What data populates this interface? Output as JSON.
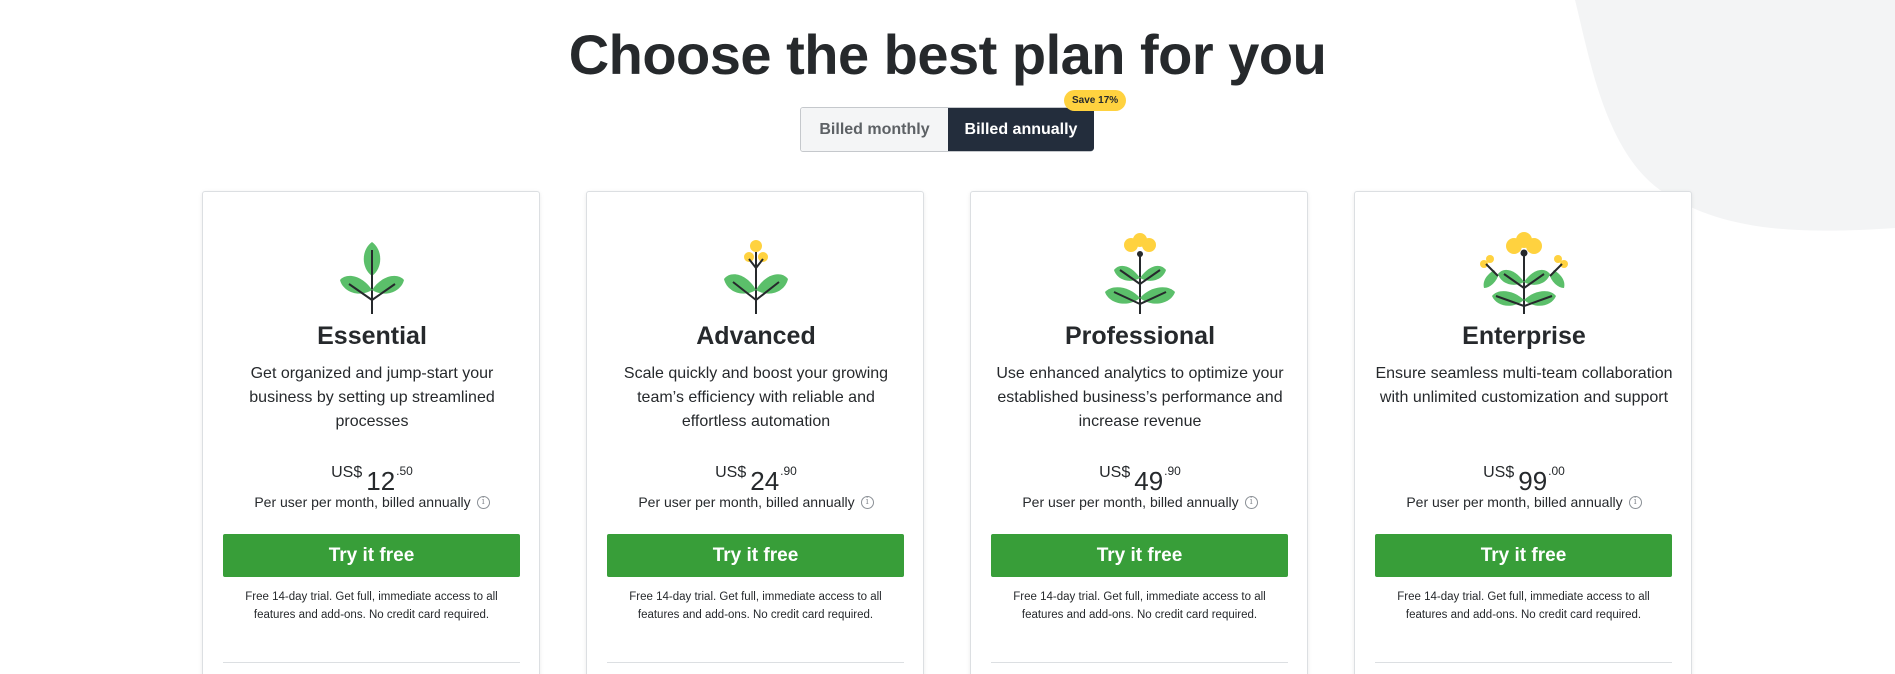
{
  "page": {
    "title": "Choose the best plan for you"
  },
  "billing_toggle": {
    "monthly_label": "Billed monthly",
    "annual_label": "Billed annually",
    "selected": "annual",
    "save_badge": "Save 17%"
  },
  "colors": {
    "dark_navy": "#232d3c",
    "cta_green": "#389e39",
    "leaf_green": "#5bbf6a",
    "flower_yellow": "#ffd23f",
    "badge_yellow": "#ffd23f",
    "background_blob": "#f4f5f6"
  },
  "plans": [
    {
      "name": "Essential",
      "icon": "plant-sprout-icon",
      "description": "Get organized and jump-start your business by setting up streamlined processes",
      "currency": "US$",
      "price_whole": "12",
      "price_cents": ".50",
      "billing_note": "Per user per month, billed annually",
      "cta": "Try it free",
      "trial_note": "Free 14-day trial. Get full, immediate access to all features and add-ons. No credit card required."
    },
    {
      "name": "Advanced",
      "icon": "plant-budding-icon",
      "description": "Scale quickly and boost your growing team’s efficiency with reliable and effortless automation",
      "currency": "US$",
      "price_whole": "24",
      "price_cents": ".90",
      "billing_note": "Per user per month, billed annually",
      "cta": "Try it free",
      "trial_note": "Free 14-day trial. Get full, immediate access to all features and add-ons. No credit card required."
    },
    {
      "name": "Professional",
      "icon": "plant-flowering-icon",
      "description": "Use enhanced analytics to optimize your established business’s performance and increase revenue",
      "currency": "US$",
      "price_whole": "49",
      "price_cents": ".90",
      "billing_note": "Per user per month, billed annually",
      "cta": "Try it free",
      "trial_note": "Free 14-day trial. Get full, immediate access to all features and add-ons. No credit card required."
    },
    {
      "name": "Enterprise",
      "icon": "plant-blooming-icon",
      "description": "Ensure seamless multi-team collaboration with unlimited customization and support",
      "currency": "US$",
      "price_whole": "99",
      "price_cents": ".00",
      "billing_note": "Per user per month, billed annually",
      "cta": "Try it free",
      "trial_note": "Free 14-day trial. Get full, immediate access to all features and add-ons. No credit card required."
    }
  ]
}
